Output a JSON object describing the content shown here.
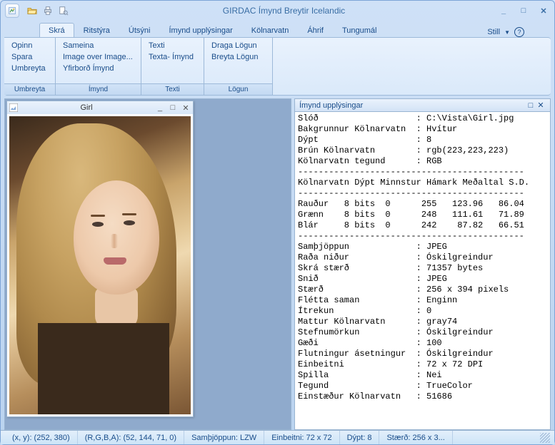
{
  "window": {
    "title": "GIRDAC Ímynd Breytir Icelandic",
    "qat_icons": [
      "folder-open-icon",
      "print-icon",
      "print-preview-icon"
    ]
  },
  "tabs": {
    "items": [
      "Skrá",
      "Ritstýra",
      "Útsýni",
      "Ímynd upplýsingar",
      "Kölnarvatn",
      "Áhrif",
      "Tungumál"
    ],
    "active": 0,
    "right_label": "Still"
  },
  "ribbon": {
    "groups": [
      {
        "label": "Umbreyta",
        "commands": [
          "Opinn",
          "Spara",
          "Umbreyta"
        ]
      },
      {
        "label": "Ímynd",
        "commands": [
          "Sameina",
          "Image over Image...",
          "Yfirborð Ímynd"
        ]
      },
      {
        "label": "Texti",
        "commands": [
          "Texti",
          "Texta- Ímynd"
        ]
      },
      {
        "label": "Lögun",
        "commands": [
          "Draga Lögun",
          "Breyta Lögun"
        ]
      }
    ]
  },
  "mdi": {
    "child_title": "Girl"
  },
  "info_panel": {
    "title": "Ímynd upplýsingar",
    "rows": [
      {
        "k": "Slóð",
        "v": "C:\\Vista\\Girl.jpg"
      },
      {
        "k": "Bakgrunnur Kölnarvatn",
        "v": "Hvítur"
      },
      {
        "k": "Dýpt",
        "v": "8"
      },
      {
        "k": "Brún Kölnarvatn",
        "v": "rgb(223,223,223)"
      },
      {
        "k": "Kölnarvatn tegund",
        "v": "RGB"
      }
    ],
    "stats_header": "Kölnarvatn Dýpt Minnstur Hámark Meðaltal S.D.",
    "stats": [
      {
        "c": "Rauður",
        "d": "8 bits",
        "min": "0",
        "max": "255",
        "mean": "123.96",
        "sd": "86.04"
      },
      {
        "c": "Grænn",
        "d": "8 bits",
        "min": "0",
        "max": "248",
        "mean": "111.61",
        "sd": "71.89"
      },
      {
        "c": "Blár",
        "d": "8 bits",
        "min": "0",
        "max": "242",
        "mean": "87.82",
        "sd": "66.51"
      }
    ],
    "rows2": [
      {
        "k": "Samþjöppun",
        "v": "JPEG"
      },
      {
        "k": "Raða niður",
        "v": "Óskilgreindur"
      },
      {
        "k": "Skrá stærð",
        "v": "71357 bytes"
      },
      {
        "k": "Snið",
        "v": "JPEG"
      },
      {
        "k": "Stærð",
        "v": "256 x 394 pixels"
      },
      {
        "k": "Flétta saman",
        "v": "Enginn"
      },
      {
        "k": "Ítrekun",
        "v": "0"
      },
      {
        "k": "Mattur Kölnarvatn",
        "v": "gray74"
      },
      {
        "k": "Stefnumörkun",
        "v": "Óskilgreindur"
      },
      {
        "k": "Gæði",
        "v": "100"
      },
      {
        "k": "Flutningur ásetningur",
        "v": "Óskilgreindur"
      },
      {
        "k": "Einbeitni",
        "v": "72 x 72 DPI"
      },
      {
        "k": "Spilla",
        "v": "Nei"
      },
      {
        "k": "Tegund",
        "v": "TrueColor"
      },
      {
        "k": "Einstæður Kölnarvatn",
        "v": "51686"
      }
    ]
  },
  "status": {
    "xy_label": "(x, y): (252, 380)",
    "rgba_label": "(R,G,B,A): (52, 144, 71, 0)",
    "compression": "Samþjöppun: LZW",
    "resolution": "Einbeitni: 72 x 72",
    "depth": "Dýpt: 8",
    "size": "Stærð: 256 x 3..."
  }
}
